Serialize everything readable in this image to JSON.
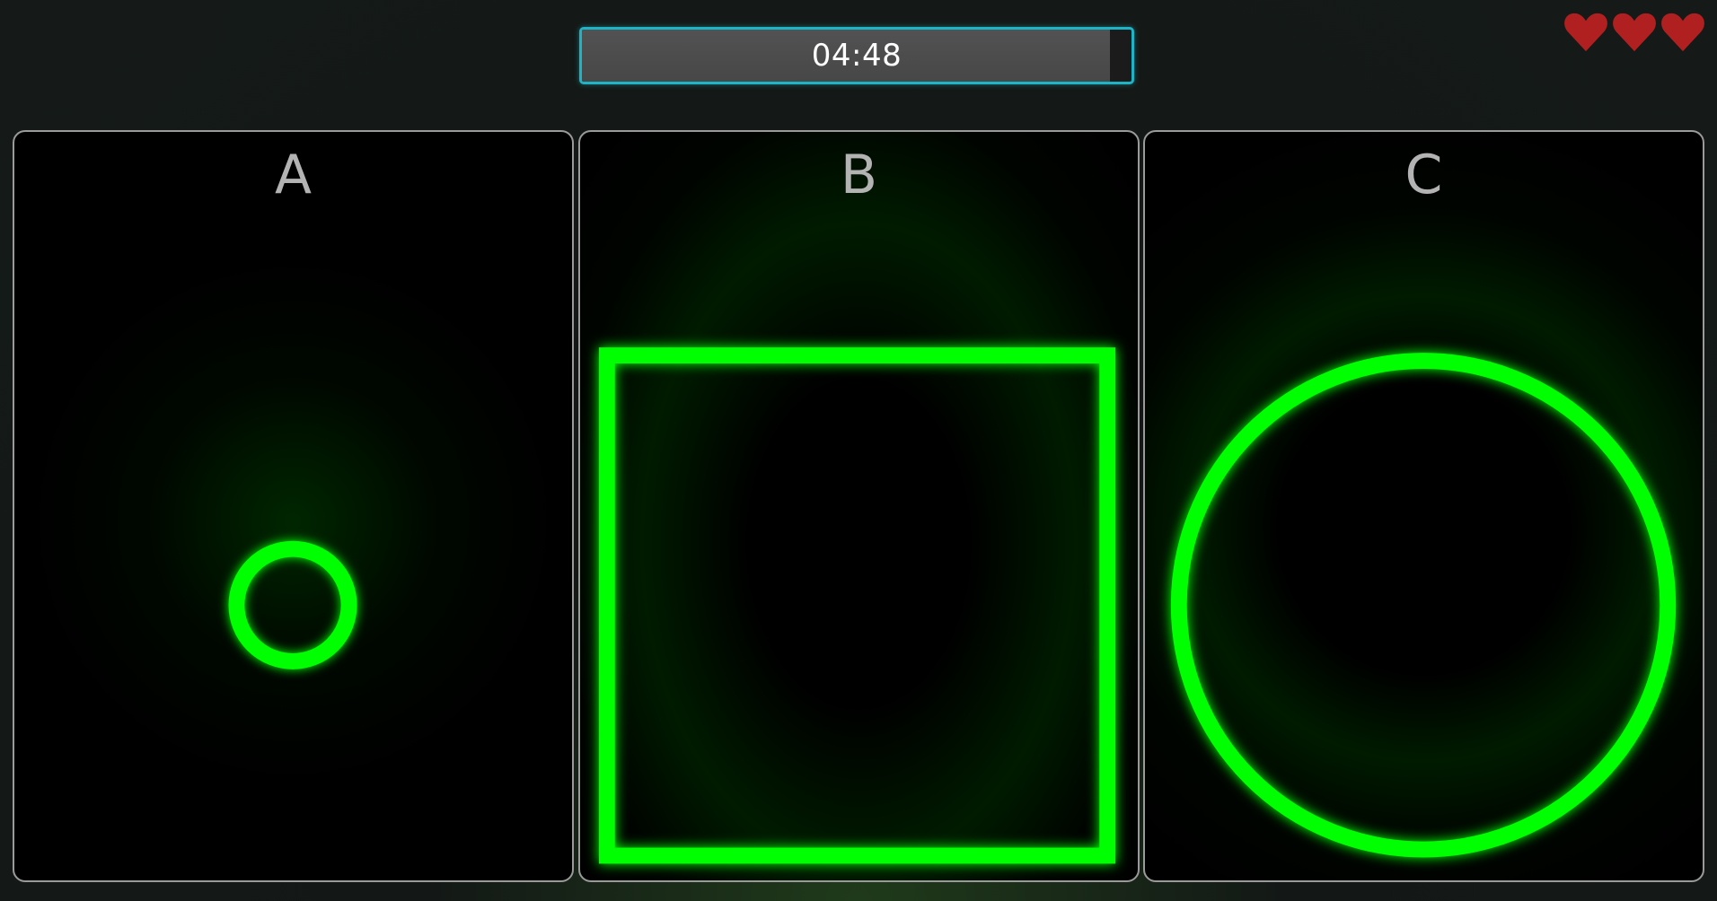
{
  "timer": {
    "text": "04:48",
    "remaining_fraction": 0.96,
    "fill_color": "#4d4d4d",
    "border_color": "#1fb3c6"
  },
  "lives": {
    "count": 3,
    "color": "#b02020",
    "icon": "heart-icon"
  },
  "panels": [
    {
      "label": "A",
      "shape": "small-circle"
    },
    {
      "label": "B",
      "shape": "square"
    },
    {
      "label": "C",
      "shape": "large-circle"
    }
  ],
  "colors": {
    "shape_stroke": "#00ff00",
    "panel_border": "#9a9a9a",
    "label": "#b3b3b3"
  }
}
